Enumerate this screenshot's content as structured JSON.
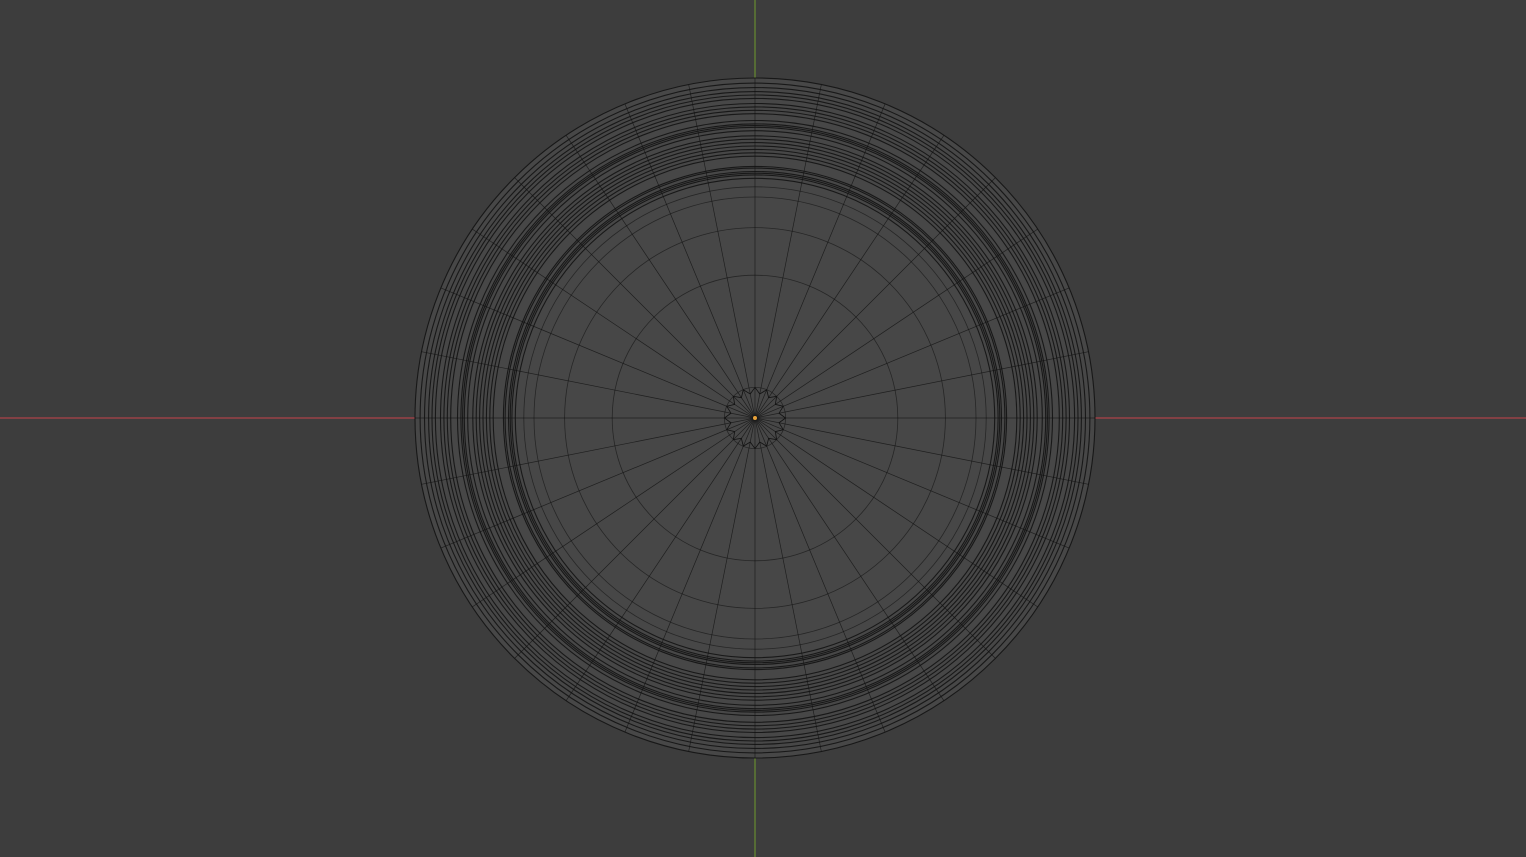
{
  "viewport": {
    "background_color": "#3d3d3d",
    "mesh_fill_color": "#474747",
    "wire_color": "#111111",
    "x_axis_color": "#c8424c",
    "y_axis_color": "#6e9a2d",
    "origin_color": "#e8a23a",
    "view": "top-orthographic",
    "shading": "wireframe-overlay"
  },
  "mesh": {
    "object": "cylindrical-object",
    "radial_segments": 32,
    "edge_loops_normalized_radius": [
      1.0,
      0.985,
      0.972,
      0.96,
      0.95,
      0.94,
      0.925,
      0.915,
      0.905,
      0.895,
      0.875,
      0.865,
      0.86,
      0.855,
      0.845,
      0.83,
      0.82,
      0.81,
      0.8,
      0.79,
      0.78,
      0.77,
      0.74,
      0.735,
      0.725,
      0.72,
      0.715,
      0.705,
      0.68,
      0.65,
      0.56,
      0.42,
      0.09
    ],
    "inner_spoke_start_normalized_radius": 0.0
  }
}
